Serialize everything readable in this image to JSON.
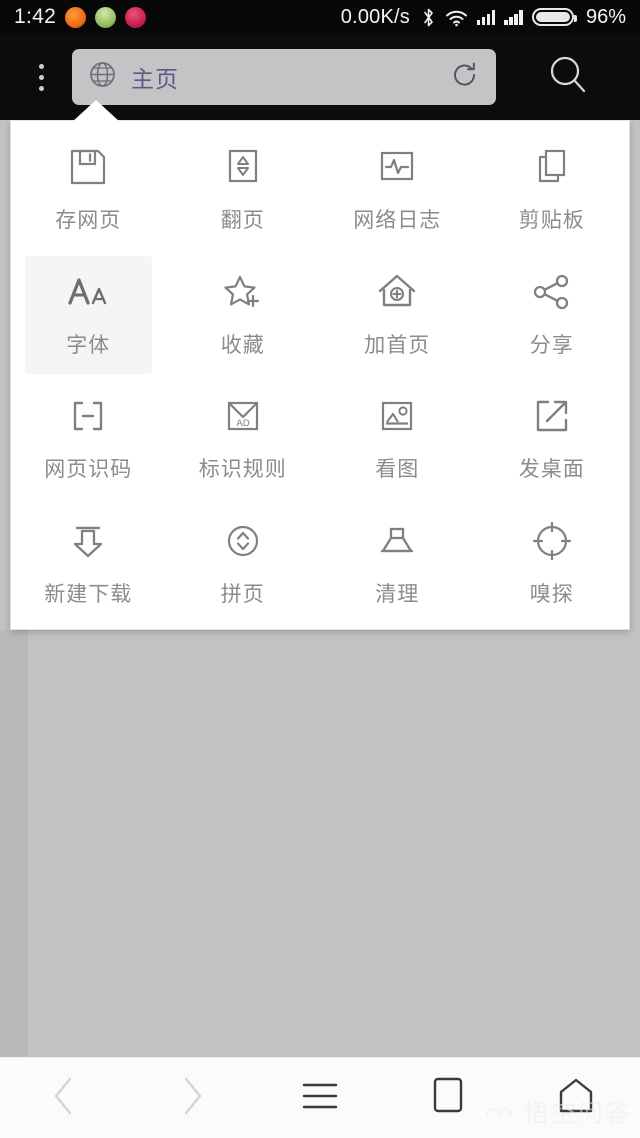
{
  "status_bar": {
    "clock": "1:42",
    "network_speed": "0.00K/s",
    "battery_percent": "96%",
    "notification_icons": [
      "orange-app-icon",
      "green-app-icon",
      "red-app-icon"
    ],
    "system_icons": [
      "bluetooth-icon",
      "wifi-icon",
      "signal-icon-sim1",
      "signal-icon-sim2",
      "battery-icon"
    ],
    "battery_level": 96
  },
  "top_bar": {
    "menu_label": "kebab-menu",
    "url_text": "主页",
    "url_placeholder": "主页",
    "globe_icon": "globe-icon",
    "refresh_icon": "refresh-icon",
    "search_icon": "search-icon",
    "url_text_color": "#5b5a86",
    "url_bg_color": "#c4c4c6",
    "bar_bg_color": "#0c0c0c"
  },
  "menu_panel": {
    "items": [
      {
        "label": "存网页",
        "icon": "floppy-disk-icon",
        "pressed": false
      },
      {
        "label": "翻页",
        "icon": "page-turn-icon",
        "pressed": false
      },
      {
        "label": "网络日志",
        "icon": "network-log-icon",
        "pressed": false
      },
      {
        "label": "剪贴板",
        "icon": "clipboard-icon",
        "pressed": false
      },
      {
        "label": "字体",
        "icon": "font-size-icon",
        "pressed": true
      },
      {
        "label": "收藏",
        "icon": "star-add-icon",
        "pressed": false
      },
      {
        "label": "加首页",
        "icon": "home-add-icon",
        "pressed": false
      },
      {
        "label": "分享",
        "icon": "share-icon",
        "pressed": false
      },
      {
        "label": "网页识码",
        "icon": "bracket-minus-icon",
        "pressed": false
      },
      {
        "label": "标识规则",
        "icon": "ad-envelope-icon",
        "pressed": false
      },
      {
        "label": "看图",
        "icon": "image-icon",
        "pressed": false
      },
      {
        "label": "发桌面",
        "icon": "external-link-icon",
        "pressed": false
      },
      {
        "label": "新建下载",
        "icon": "download-icon",
        "pressed": false
      },
      {
        "label": "拼页",
        "icon": "merge-pages-icon",
        "pressed": false
      },
      {
        "label": "清理",
        "icon": "clean-icon",
        "pressed": false
      },
      {
        "label": "嗅探",
        "icon": "sniff-crosshair-icon",
        "pressed": false
      }
    ],
    "bg_color": "#ffffff",
    "label_color": "#8c8c8c",
    "icon_color": "#808080"
  },
  "page_area": {
    "bg_color": "#c2c2c4"
  },
  "bottom_nav": {
    "items": [
      {
        "name": "back",
        "icon": "chevron-left-icon",
        "enabled": false
      },
      {
        "name": "forward",
        "icon": "chevron-right-icon",
        "enabled": false
      },
      {
        "name": "menu",
        "icon": "hamburger-icon",
        "enabled": true
      },
      {
        "name": "tabs",
        "icon": "square-icon",
        "enabled": true
      },
      {
        "name": "home",
        "icon": "home-icon",
        "enabled": true
      }
    ],
    "bg_color": "#fbfbfb"
  },
  "watermark": {
    "text": "悟空问答",
    "mark": "watermark-logo"
  }
}
